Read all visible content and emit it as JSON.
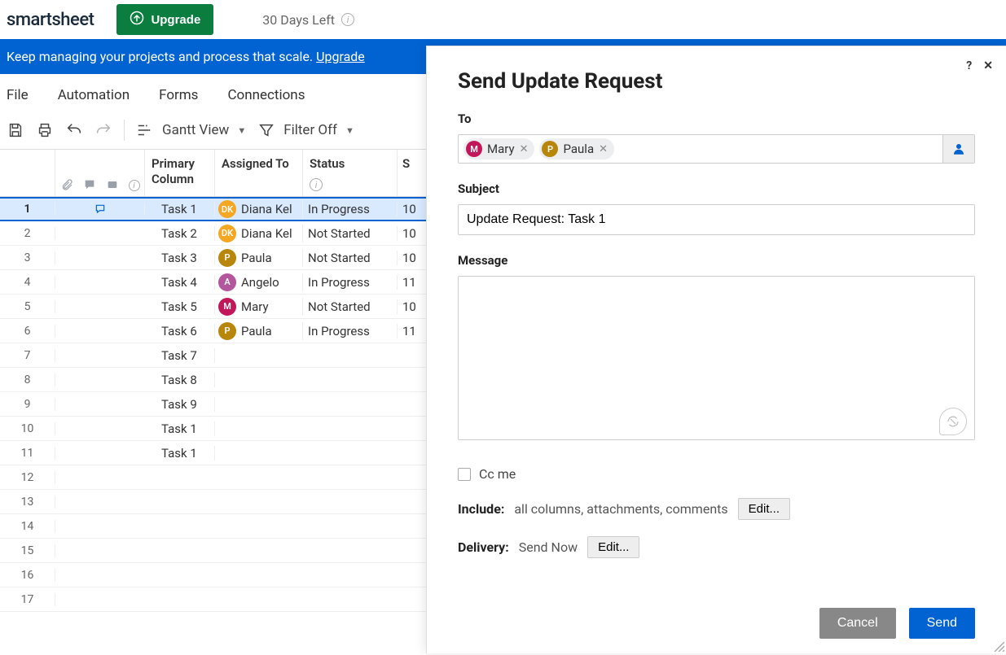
{
  "topbar": {
    "brand": "smartsheet",
    "upgrade_label": "Upgrade",
    "days_left": "30 Days Left"
  },
  "banner": {
    "text": "Keep managing your projects and process that scale. ",
    "link": "Upgrade"
  },
  "menubar": {
    "file": "File",
    "automation": "Automation",
    "forms": "Forms",
    "connections": "Connections"
  },
  "toolbar": {
    "view_label": "Gantt View",
    "filter_label": "Filter Off"
  },
  "grid": {
    "headers": {
      "primary": "Primary Column",
      "assigned": "Assigned To",
      "status": "Status",
      "start": "S"
    },
    "rows": [
      {
        "n": 1,
        "selected": true,
        "has_comment": true,
        "primary": "Task 1",
        "assignee": "Diana Kel",
        "initials": "DK",
        "color": "#f5a623",
        "status": "In Progress",
        "start": "10"
      },
      {
        "n": 2,
        "selected": false,
        "has_comment": false,
        "primary": "Task 2",
        "assignee": "Diana Kel",
        "initials": "DK",
        "color": "#f5a623",
        "status": "Not Started",
        "start": "10"
      },
      {
        "n": 3,
        "selected": false,
        "has_comment": false,
        "primary": "Task 3",
        "assignee": "Paula",
        "initials": "P",
        "color": "#b8860b",
        "status": "Not Started",
        "start": "10"
      },
      {
        "n": 4,
        "selected": false,
        "has_comment": false,
        "primary": "Task 4",
        "assignee": "Angelo",
        "initials": "A",
        "color": "#b3569e",
        "status": "In Progress",
        "start": "11"
      },
      {
        "n": 5,
        "selected": false,
        "has_comment": false,
        "primary": "Task 5",
        "assignee": "Mary",
        "initials": "M",
        "color": "#c2185b",
        "status": "Not Started",
        "start": "10"
      },
      {
        "n": 6,
        "selected": false,
        "has_comment": false,
        "primary": "Task 6",
        "assignee": "Paula",
        "initials": "P",
        "color": "#b8860b",
        "status": "In Progress",
        "start": "11"
      },
      {
        "n": 7,
        "selected": false,
        "has_comment": false,
        "primary": "Task 7",
        "assignee": "",
        "initials": "",
        "color": "",
        "status": "",
        "start": ""
      },
      {
        "n": 8,
        "selected": false,
        "has_comment": false,
        "primary": "Task 8",
        "assignee": "",
        "initials": "",
        "color": "",
        "status": "",
        "start": ""
      },
      {
        "n": 9,
        "selected": false,
        "has_comment": false,
        "primary": "Task 9",
        "assignee": "",
        "initials": "",
        "color": "",
        "status": "",
        "start": ""
      },
      {
        "n": 10,
        "selected": false,
        "has_comment": false,
        "primary": "Task 1",
        "assignee": "",
        "initials": "",
        "color": "",
        "status": "",
        "start": ""
      },
      {
        "n": 11,
        "selected": false,
        "has_comment": false,
        "primary": "Task 1",
        "assignee": "",
        "initials": "",
        "color": "",
        "status": "",
        "start": ""
      },
      {
        "n": 12,
        "selected": false,
        "has_comment": false,
        "primary": "",
        "assignee": "",
        "initials": "",
        "color": "",
        "status": "",
        "start": ""
      },
      {
        "n": 13,
        "selected": false,
        "has_comment": false,
        "primary": "",
        "assignee": "",
        "initials": "",
        "color": "",
        "status": "",
        "start": ""
      },
      {
        "n": 14,
        "selected": false,
        "has_comment": false,
        "primary": "",
        "assignee": "",
        "initials": "",
        "color": "",
        "status": "",
        "start": ""
      },
      {
        "n": 15,
        "selected": false,
        "has_comment": false,
        "primary": "",
        "assignee": "",
        "initials": "",
        "color": "",
        "status": "",
        "start": ""
      },
      {
        "n": 16,
        "selected": false,
        "has_comment": false,
        "primary": "",
        "assignee": "",
        "initials": "",
        "color": "",
        "status": "",
        "start": ""
      },
      {
        "n": 17,
        "selected": false,
        "has_comment": false,
        "primary": "",
        "assignee": "",
        "initials": "",
        "color": "",
        "status": "",
        "start": ""
      }
    ]
  },
  "panel": {
    "title": "Send Update Request",
    "to_label": "To",
    "recipients": [
      {
        "name": "Mary",
        "initials": "M",
        "color": "#c2185b"
      },
      {
        "name": "Paula",
        "initials": "P",
        "color": "#b8860b"
      }
    ],
    "subject_label": "Subject",
    "subject_value": "Update Request: Task 1",
    "message_label": "Message",
    "message_value": "",
    "cc_label": "Cc me",
    "include_label": "Include:",
    "include_value": "all columns, attachments, comments",
    "delivery_label": "Delivery:",
    "delivery_value": "Send Now",
    "edit_label": "Edit...",
    "cancel_label": "Cancel",
    "send_label": "Send"
  }
}
